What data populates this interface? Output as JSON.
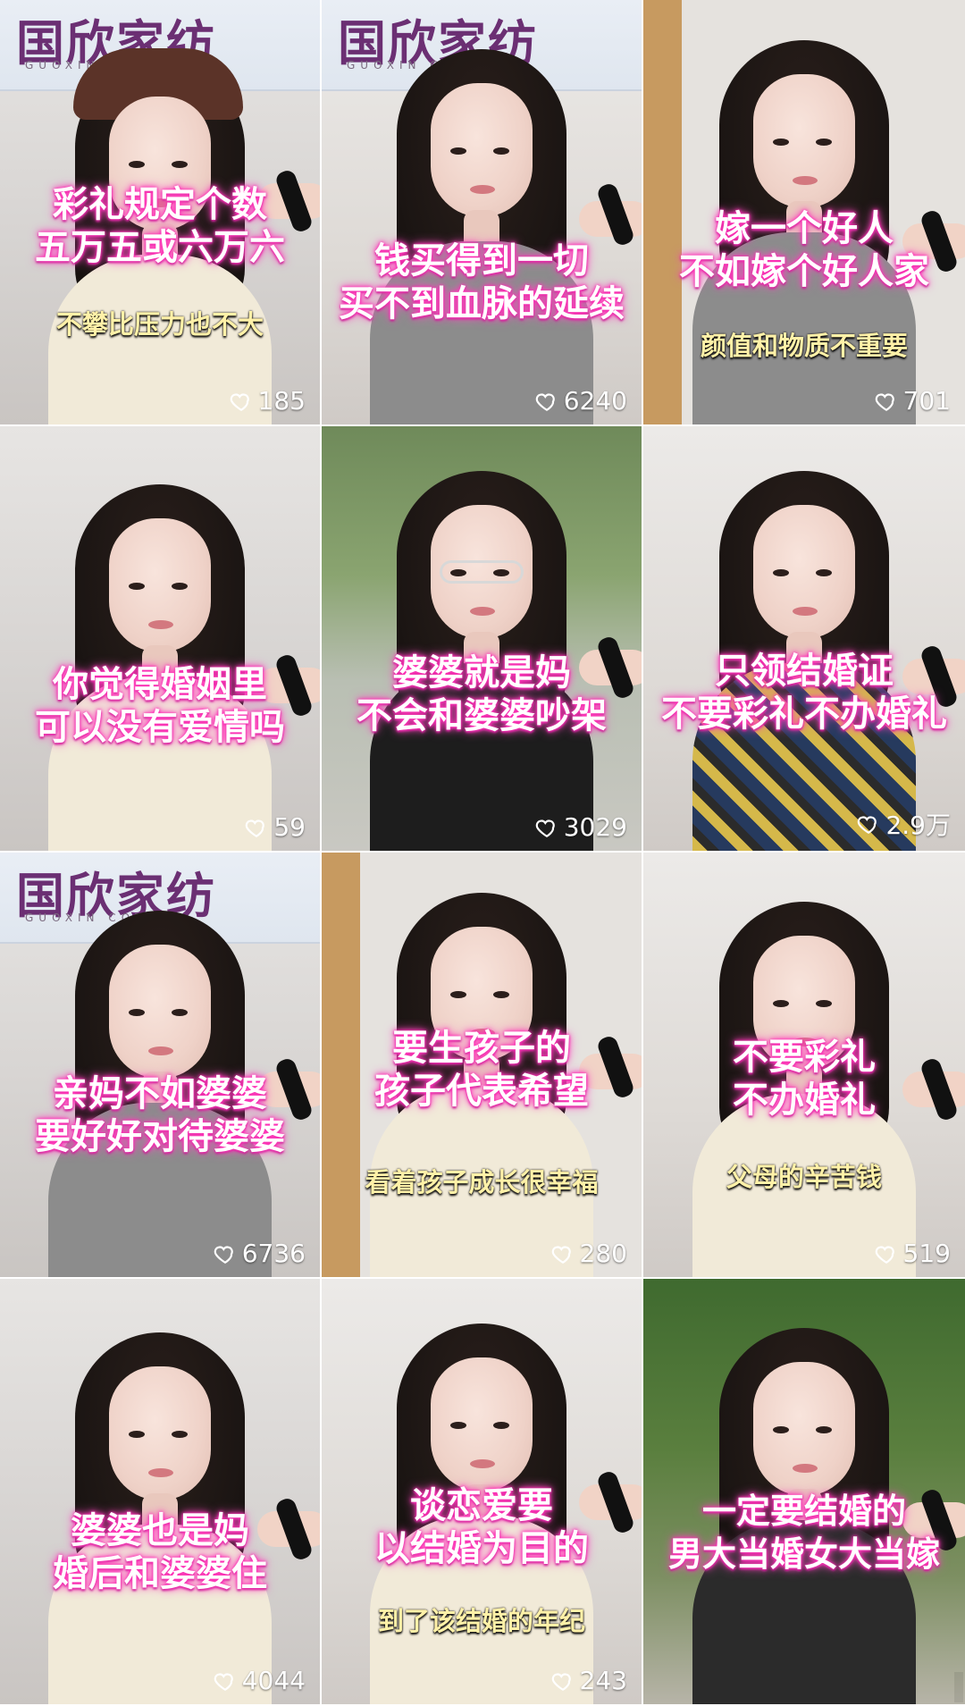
{
  "feed": {
    "items": [
      {
        "caption_lines": [
          "彩礼规定个数",
          "五万五或六万六"
        ],
        "subcaption": "不攀比压力也不大",
        "likes": "185",
        "banner_title": "国欣家纺",
        "banner_sub": "GUOXIN COTTON",
        "bg": "wall",
        "outfit": "cream",
        "cap": true
      },
      {
        "caption_lines": [
          "钱买得到一切",
          "买不到血脉的延续"
        ],
        "subcaption": "",
        "likes": "6240",
        "banner_title": "国欣家纺",
        "banner_sub": "GUOXIN COTTON",
        "bg": "wall2",
        "outfit": "gray"
      },
      {
        "caption_lines": [
          "嫁一个好人",
          "不如嫁个好人家"
        ],
        "subcaption": "颜值和物质不重要",
        "likes": "701",
        "bg": "wood",
        "outfit": "gray"
      },
      {
        "caption_lines": [
          "你觉得婚姻里",
          "可以没有爱情吗"
        ],
        "subcaption": "",
        "likes": "59",
        "bg": "wall",
        "outfit": "cream"
      },
      {
        "caption_lines": [
          "婆婆就是妈",
          "不会和婆婆吵架"
        ],
        "subcaption": "",
        "likes": "3029",
        "bg": "tree",
        "outfit": "black",
        "glasses": true
      },
      {
        "caption_lines": [
          "只领结婚证",
          "不要彩礼不办婚礼"
        ],
        "subcaption": "",
        "likes": "2.9万",
        "bg": "wall2",
        "outfit": "plaid"
      },
      {
        "caption_lines": [
          "亲妈不如婆婆",
          "要好好对待婆婆"
        ],
        "subcaption": "",
        "likes": "6736",
        "banner_title": "国欣家纺",
        "banner_sub": "GUOXIN COTTON",
        "bg": "wall",
        "outfit": "gray"
      },
      {
        "caption_lines": [
          "要生孩子的",
          "孩子代表希望"
        ],
        "subcaption": "看着孩子成长很幸福",
        "likes": "280",
        "bg": "wood",
        "outfit": "cream"
      },
      {
        "caption_lines": [
          "不要彩礼",
          "不办婚礼"
        ],
        "subcaption": "父母的辛苦钱",
        "likes": "519",
        "bg": "wall2",
        "outfit": "cream"
      },
      {
        "caption_lines": [
          "婆婆也是妈",
          "婚后和婆婆住"
        ],
        "subcaption": "",
        "likes": "4044",
        "bg": "wall",
        "outfit": "cream"
      },
      {
        "caption_lines": [
          "谈恋爱要",
          "以结婚为目的"
        ],
        "subcaption": "到了该结婚的年纪",
        "likes": "243",
        "bg": "wall2",
        "outfit": "cream"
      },
      {
        "caption_lines": [
          "一定要结婚的",
          "男大当婚女大当嫁"
        ],
        "subcaption": "",
        "likes": "",
        "bg": "flowers",
        "outfit": "dark"
      }
    ]
  }
}
